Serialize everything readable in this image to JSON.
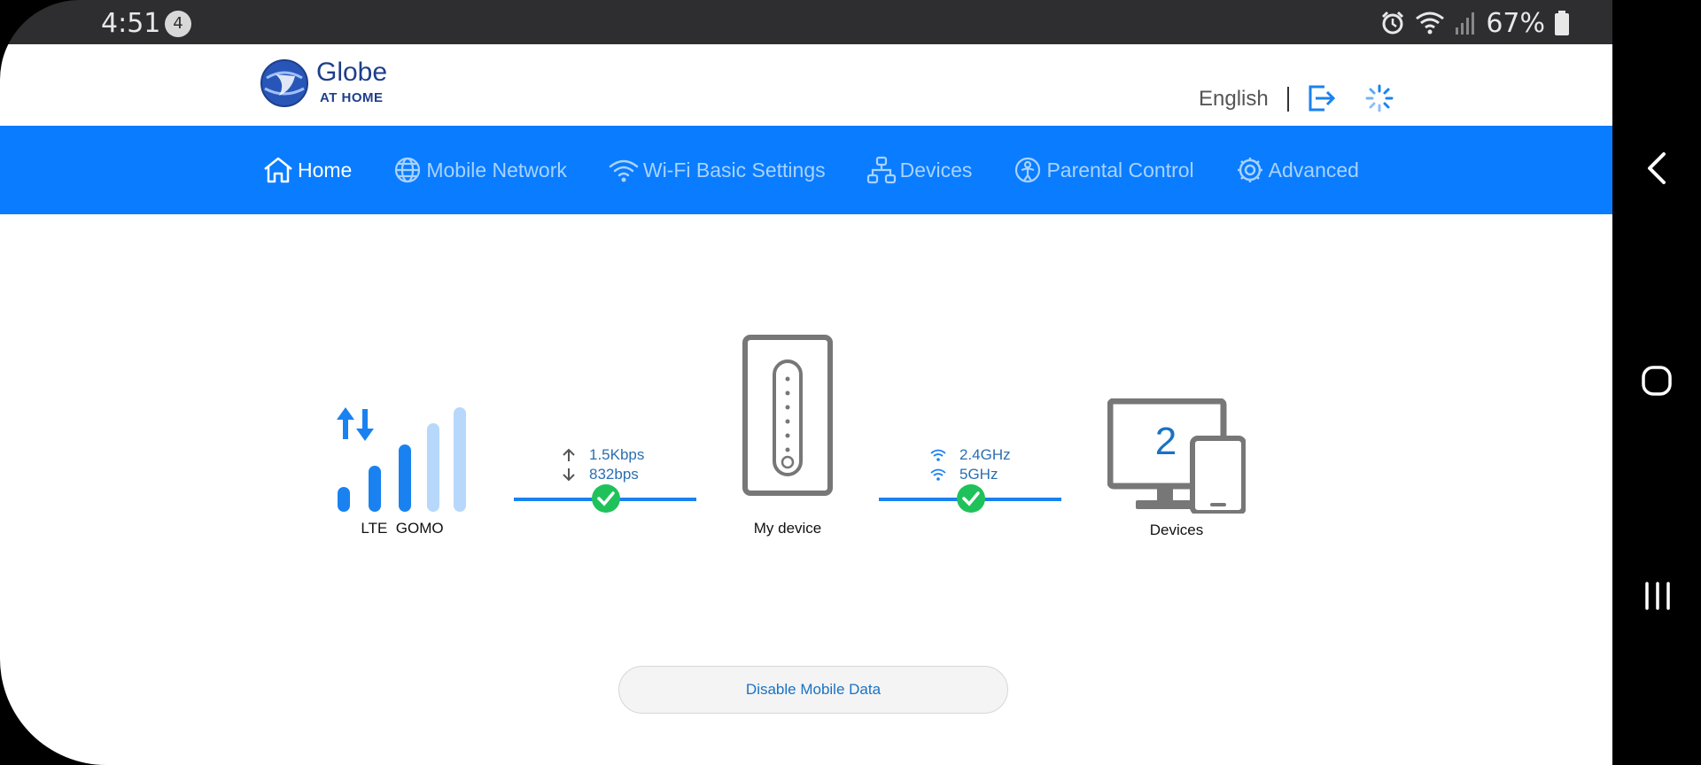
{
  "status_bar": {
    "time": "4:51",
    "notification_count": "4",
    "battery_text": "67%",
    "icons": [
      "alarm-icon",
      "wifi-icon",
      "signal-icon",
      "battery-icon"
    ]
  },
  "header": {
    "logo_title": "Globe",
    "logo_subtitle": "AT HOME",
    "language": "English"
  },
  "nav": {
    "items": [
      {
        "label": "Home",
        "icon": "home-icon",
        "active": true
      },
      {
        "label": "Mobile Network",
        "icon": "globe-icon",
        "active": false
      },
      {
        "label": "Wi-Fi Basic Settings",
        "icon": "wifi-icon",
        "active": false
      },
      {
        "label": "Devices",
        "icon": "devices-tree-icon",
        "active": false
      },
      {
        "label": "Parental Control",
        "icon": "parental-icon",
        "active": false
      },
      {
        "label": "Advanced",
        "icon": "gear-icon",
        "active": false
      }
    ]
  },
  "topology": {
    "network_label": "LTE  GOMO",
    "upload_rate": "1.5Kbps",
    "download_rate": "832bps",
    "router_label": "My device",
    "band_1": "2.4GHz",
    "band_2": "5GHz",
    "device_count": "2",
    "devices_label": "Devices"
  },
  "actions": {
    "disable_mobile_data": "Disable Mobile Data"
  },
  "colors": {
    "nav_background": "#0a7cff",
    "nav_active_text": "#ffffff",
    "nav_inactive_text": "#a9d3ff",
    "link_bar": "#1a82f0",
    "check_green": "#1fc25a",
    "brand_blue": "#1e3e8c"
  }
}
